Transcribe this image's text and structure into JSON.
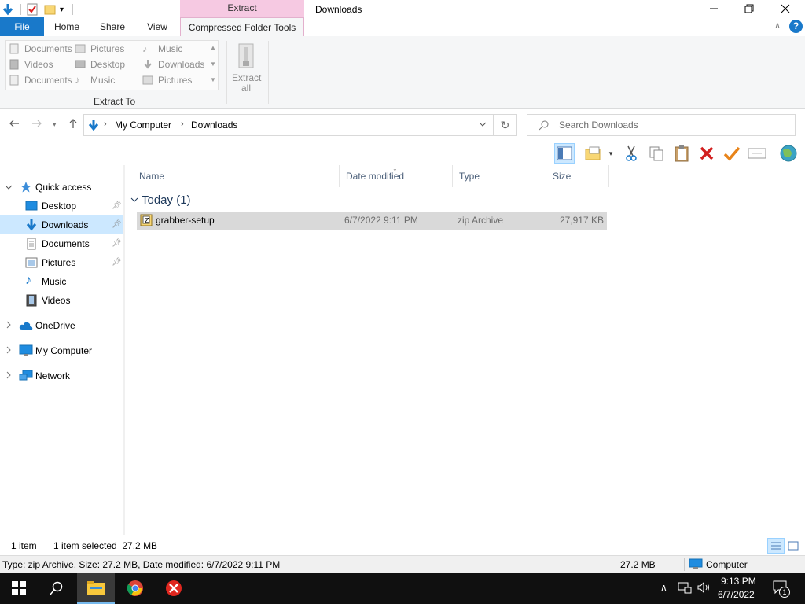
{
  "window": {
    "title": "Downloads",
    "context_header": "Extract"
  },
  "ribbon": {
    "tabs": {
      "file": "File",
      "home": "Home",
      "share": "Share",
      "view": "View",
      "compressed": "Compressed Folder Tools"
    },
    "gallery": {
      "col1": [
        "Documents",
        "Videos",
        "Documents"
      ],
      "col2": [
        "Pictures",
        "Desktop",
        "Music"
      ],
      "col3": [
        "Music",
        "Downloads",
        "Pictures"
      ]
    },
    "extract_to_label": "Extract To",
    "extract_all_line1": "Extract",
    "extract_all_line2": "all"
  },
  "address": {
    "crumbs": [
      "My Computer",
      "Downloads"
    ],
    "search_placeholder": "Search Downloads"
  },
  "nav": {
    "quick_access": "Quick access",
    "items": [
      "Desktop",
      "Downloads",
      "Documents",
      "Pictures",
      "Music",
      "Videos"
    ],
    "onedrive": "OneDrive",
    "computer": "My Computer",
    "network": "Network"
  },
  "columns": {
    "name": "Name",
    "date": "Date modified",
    "type": "Type",
    "size": "Size"
  },
  "group": {
    "label": "Today (1)"
  },
  "files": [
    {
      "name": "grabber-setup",
      "date": "6/7/2022 9:11 PM",
      "type": "zip Archive",
      "size": "27,917 KB"
    }
  ],
  "status": {
    "count": "1 item",
    "selected": "1 item selected  27.2 MB"
  },
  "details": {
    "summary": "Type: zip Archive, Size: 27.2 MB, Date modified: 6/7/2022 9:11 PM",
    "size": "27.2 MB",
    "location": "Computer"
  },
  "taskbar": {
    "time": "9:13 PM",
    "date": "6/7/2022",
    "notifications": "1"
  },
  "colors": {
    "accent": "#1979ca",
    "context_tab": "#f6c9e2",
    "selection": "#cce8ff",
    "row_selected": "#d9d9d9"
  }
}
